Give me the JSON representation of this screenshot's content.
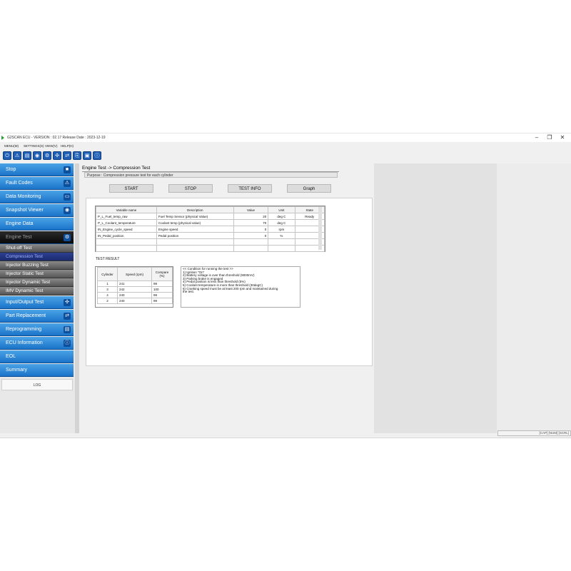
{
  "window": {
    "title": "G2SCAN ECU - VERSION : 02.17 Release Date : 2023-12-19",
    "controls": [
      "–",
      "❐",
      "✕"
    ]
  },
  "menu": [
    "MENU(M)",
    "SETTINGS(S)",
    "VIEW(V)",
    "HELP(H)"
  ],
  "toolbar": [
    "⏻",
    "⚠",
    "▤",
    "◉",
    "⚙",
    "✣",
    "⇄",
    "⎘",
    "▣",
    "ⓘ"
  ],
  "sidebar": {
    "items": [
      {
        "label": "Stop",
        "icon": "■"
      },
      {
        "label": "Fault Codes",
        "icon": "⚠"
      },
      {
        "label": "Data Monitoring",
        "icon": "▭"
      },
      {
        "label": "Snapshot Viewer",
        "icon": "◉"
      },
      {
        "label": "Engine Data",
        "icon": ""
      },
      {
        "label": "Engine Test",
        "icon": "⚙"
      }
    ],
    "subitems": [
      "Shut-off Test",
      "Compression Test",
      "Injector Buzzing Test",
      "Injector Static Test",
      "Injector Dynamic Test",
      "IMV Dynamic Test"
    ],
    "items2": [
      {
        "label": "Input/Output Test",
        "icon": "✣"
      },
      {
        "label": "Part Replacement",
        "icon": "⇄"
      },
      {
        "label": "Reprogramming",
        "icon": "▤"
      },
      {
        "label": "ECU Information",
        "icon": "ⓘ"
      },
      {
        "label": "EOL",
        "icon": ""
      },
      {
        "label": "Summary",
        "icon": ""
      }
    ],
    "log_label": "LOG"
  },
  "breadcrumb": "Engine Test -> Compression Test",
  "purpose": "Purpose :  Compression pressure test for each cylinder",
  "buttons": {
    "start": "START",
    "stop": "STOP",
    "info": "TEST INFO",
    "graph": "Graph"
  },
  "variables": {
    "headers": [
      "Variable name",
      "Description",
      "Value",
      "Unit",
      "State"
    ],
    "rows": [
      [
        "P_L_Fuel_temp_raw",
        "Fuel Temp Sensor (physical Value)",
        "20",
        "deg C",
        "Ready"
      ],
      [
        "P_L_Coolant_temperature",
        "Coolant temp (physical value)",
        "70",
        "deg C",
        ""
      ],
      [
        "IN_Engine_cycle_speed",
        "Engine speed",
        "0",
        "rpm",
        ""
      ],
      [
        "IN_Pedal_position",
        "Pedal position",
        "0",
        "%",
        ""
      ],
      [
        "",
        "",
        "",
        "",
        ""
      ],
      [
        "",
        "",
        "",
        "",
        ""
      ]
    ]
  },
  "test_result": {
    "label": "TEST RESULT",
    "headers": [
      "Cylinder",
      "Speed\n(rpm)",
      "Compare\n(%)"
    ],
    "rows": [
      [
        "1",
        "241",
        "99"
      ],
      [
        "3",
        "242",
        "100"
      ],
      [
        "4",
        "240",
        "99"
      ],
      [
        "2",
        "240",
        "99"
      ]
    ]
  },
  "conditions": [
    "<< Condition for running the test >>",
    "1) Ignition \"On\"",
    "2) Battery voltage is over than threshold (9000mV)",
    "3) Parking brake is engaged",
    "4) Pedal position is less than threshold (5%)",
    "5) Coolant temperature is more than threshold (30degC)",
    "6) Cranking speed must be at least 200 rpm and maintained during",
    "the test."
  ],
  "status": "[CAP] [NUM] [SCRL]"
}
